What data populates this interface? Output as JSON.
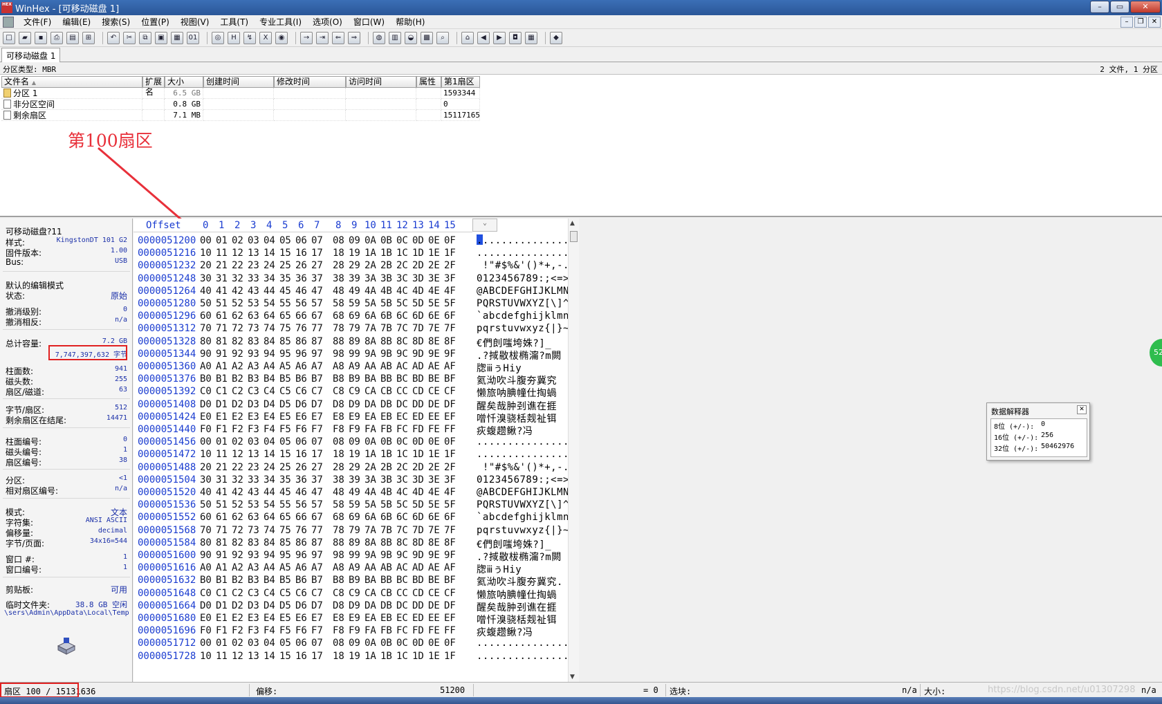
{
  "window": {
    "title": "WinHex - [可移动磁盘 1]",
    "app_icon": "HEX"
  },
  "menu": [
    "文件(F)",
    "编辑(E)",
    "搜索(S)",
    "位置(P)",
    "视图(V)",
    "工具(T)",
    "专业工具(I)",
    "选项(O)",
    "窗口(W)",
    "帮助(H)"
  ],
  "tab": "可移动磁盘 1",
  "partition_info": {
    "label": "分区类型: MBR",
    "count": "2 文件, 1 分区"
  },
  "file_list": {
    "columns": [
      "文件名",
      "扩展名",
      "大小",
      "创建时间",
      "修改时间",
      "访问时间",
      "属性",
      "第1扇区"
    ],
    "sort_indicator": "▲",
    "rows": [
      {
        "name": "分区 1",
        "ext": "",
        "size": "6.5 GB",
        "first_sector": "1593344",
        "icon": "partition-icon"
      },
      {
        "name": "非分区空间",
        "ext": "",
        "size": "0.8 GB",
        "first_sector": "0",
        "icon": "file-icon"
      },
      {
        "name": "剩余扇区",
        "ext": "",
        "size": "7.1 MB",
        "first_sector": "15117165",
        "icon": "file-icon"
      }
    ]
  },
  "annotation": {
    "text": "第100扇区",
    "color": "#e8303a"
  },
  "info_panel": {
    "device": "可移动磁盘?11",
    "rows1": [
      {
        "k": "样式:",
        "v": "KingstonDT 101 G2"
      },
      {
        "k": "固件版本:",
        "v": "1.00"
      },
      {
        "k": "Bus:",
        "v": "USB"
      }
    ],
    "edit_mode_title": "默认的编辑模式",
    "rows2": [
      {
        "k": "状态:",
        "v": "原始"
      },
      {
        "k": "撤消级别:",
        "v": "0"
      },
      {
        "k": "撤消相反:",
        "v": "n/a"
      }
    ],
    "capacity": {
      "k": "总计容量:",
      "v": "7.2 GB",
      "bytes": "7,747,397,632 字节"
    },
    "rows3": [
      {
        "k": "柱面数:",
        "v": "941"
      },
      {
        "k": "磁头数:",
        "v": "255"
      },
      {
        "k": "扇区/磁道:",
        "v": "63"
      }
    ],
    "rows4": [
      {
        "k": "字节/扇区:",
        "v": "512"
      },
      {
        "k": "剩余扇区在结尾:",
        "v": "14471"
      }
    ],
    "rows5": [
      {
        "k": "柱面编号:",
        "v": "0"
      },
      {
        "k": "磁头编号:",
        "v": "1"
      },
      {
        "k": "扇区编号:",
        "v": "38"
      }
    ],
    "rows6": [
      {
        "k": "分区:",
        "v": "<1"
      },
      {
        "k": "相对扇区编号:",
        "v": "n/a"
      }
    ],
    "rows7": [
      {
        "k": "模式:",
        "v": "文本"
      },
      {
        "k": "字符集:",
        "v": "ANSI ASCII"
      },
      {
        "k": "偏移量:",
        "v": "decimal"
      },
      {
        "k": "字节/页面:",
        "v": "34x16=544"
      }
    ],
    "rows8": [
      {
        "k": "窗口 #:",
        "v": "1"
      },
      {
        "k": "窗口编号:",
        "v": "1"
      }
    ],
    "clipboard": {
      "k": "剪贴板:",
      "v": "可用"
    },
    "temp": {
      "k": "临时文件夹:",
      "v": "38.8 GB 空闲"
    },
    "temp_path": "\\sers\\Admin\\AppData\\Local\\Temp"
  },
  "hex": {
    "header_offset": "Offset",
    "header_cols": [
      "0",
      "1",
      "2",
      "3",
      "4",
      "5",
      "6",
      "7",
      "8",
      "9",
      "10",
      "11",
      "12",
      "13",
      "14",
      "15"
    ],
    "offsets": [
      "0000051200",
      "0000051216",
      "0000051232",
      "0000051248",
      "0000051264",
      "0000051280",
      "0000051296",
      "0000051312",
      "0000051328",
      "0000051344",
      "0000051360",
      "0000051376",
      "0000051392",
      "0000051408",
      "0000051424",
      "0000051440",
      "0000051456",
      "0000051472",
      "0000051488",
      "0000051504",
      "0000051520",
      "0000051536",
      "0000051552",
      "0000051568",
      "0000051584",
      "0000051600",
      "0000051616",
      "0000051632",
      "0000051648",
      "0000051664",
      "0000051680",
      "0000051696",
      "0000051712",
      "0000051728"
    ],
    "ascii": [
      "................",
      "................",
      " !\"#$%&'()*+,-./",
      "0123456789:;<=>?",
      "@ABCDEFGHIJKLMNO",
      "PQRSTUVWXYZ[\\]^_",
      "`abcdefghijklmno",
      "pqrstuvwxyz{|}~.",
      "€們剆嗤垮姝?]_",
      ".?掝敭柭椭澝?m闕",
      "牎ⅲぅΗiy",
      "氦泑吹斗腹夯冀究",
      "懒旅呐腆幢仕掏蝸",
      "醒矣哉肿刭谯在捱",
      "噌忏溴骁栝觌祉铒",
      "疢蝮趱鳅?冯",
      "...............u",
      "...............?",
      " !\"#$%&'()*+,-./",
      "0123456789:;<=>?",
      "@ABCDEFGHIJKLMNO",
      "PQRSTUVWXYZ[\\]^_",
      "`abcdefghijklmno",
      "pqrstuvwxyz{|}~.",
      "€們剆嗤垮姝?]_",
      ".?掝敭柭椭澝?m闕",
      "牎ⅲぅΗiy",
      "氦泑吹斗腹夯冀究.",
      "懒旅呐腆幢仕掏蝸",
      "醒矣哉肿刭谯在捱",
      "噌忏溴骁栝觌祉铒",
      "疢蝮趱鳅?冯",
      "................",
      "................"
    ]
  },
  "interpreter": {
    "title": "数据解释器",
    "rows": [
      {
        "k": "8位 (+/-):",
        "v": "0"
      },
      {
        "k": "16位 (+/-):",
        "v": "256"
      },
      {
        "k": "32位 (+/-):",
        "v": "50462976"
      }
    ]
  },
  "green_badge": "52",
  "status": {
    "sector": "扇区 100 / 15131636",
    "offset_label": "偏移:",
    "offset_value": "51200",
    "equals": "= 0",
    "selection_label": "选块:",
    "selection_value": "n/a",
    "size_label": "大小:",
    "size_value": "n/a"
  },
  "watermark": "https://blog.csdn.net/u01307298"
}
